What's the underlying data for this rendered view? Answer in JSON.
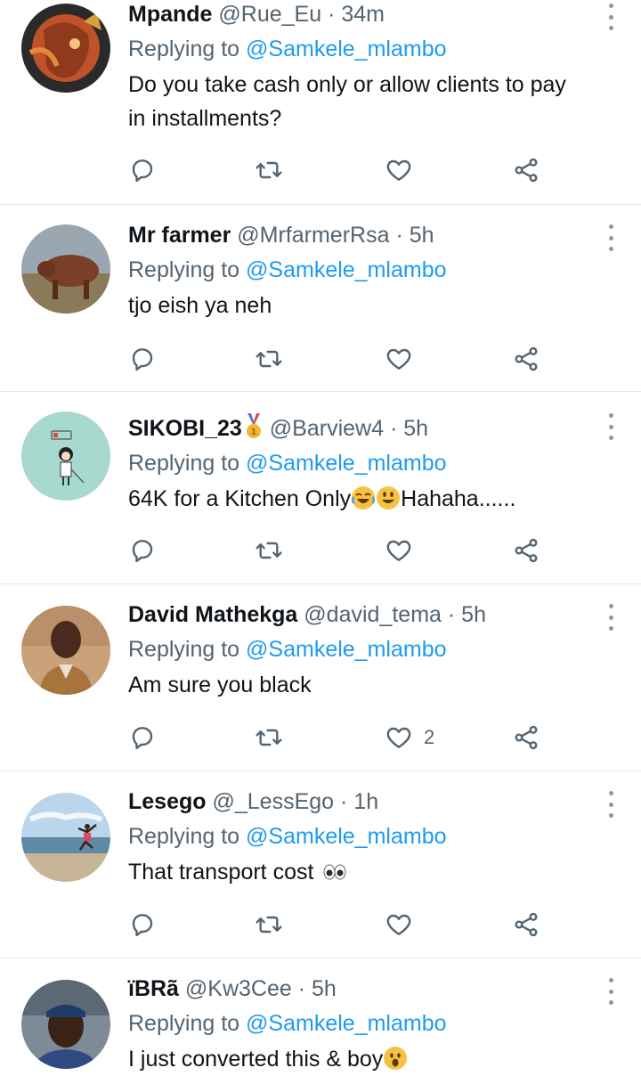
{
  "reply_prefix": "Replying to",
  "tweets": [
    {
      "name": "Mpande",
      "handle": "@Rue_Eu",
      "time": "34m",
      "replying_to": "@Samkele_mlambo",
      "text": "Do you take cash only or allow clients to pay in installments?",
      "likes": ""
    },
    {
      "name": "Mr farmer",
      "handle": "@MrfarmerRsa",
      "time": "5h",
      "replying_to": "@Samkele_mlambo",
      "text": "tjo eish ya neh",
      "likes": ""
    },
    {
      "name": "SIKOBI_23",
      "handle": "@Barview4",
      "time": "5h",
      "replying_to": "@Samkele_mlambo",
      "text_before": "64K for a Kitchen Only",
      "text_after": "Hahaha......",
      "likes": ""
    },
    {
      "name": "David Mathekga",
      "handle": "@david_tema",
      "time": "5h",
      "replying_to": "@Samkele_mlambo",
      "text": "Am sure you black",
      "likes": "2"
    },
    {
      "name": "Lesego",
      "handle": "@_LessEgo",
      "time": "1h",
      "replying_to": "@Samkele_mlambo",
      "text_before": "That transport cost",
      "likes": ""
    },
    {
      "name": "ïBRã",
      "handle": "@Kw3Cee",
      "time": "5h",
      "replying_to": "@Samkele_mlambo",
      "text_before": "I just converted this & boy",
      "likes": ""
    }
  ],
  "icons": {
    "reply": "reply-icon",
    "retweet": "retweet-icon",
    "like": "heart-icon",
    "share": "share-icon",
    "more": "more-icon"
  },
  "colors": {
    "link": "#1d9bf0",
    "secondary": "#536471",
    "icon": "#536471"
  }
}
